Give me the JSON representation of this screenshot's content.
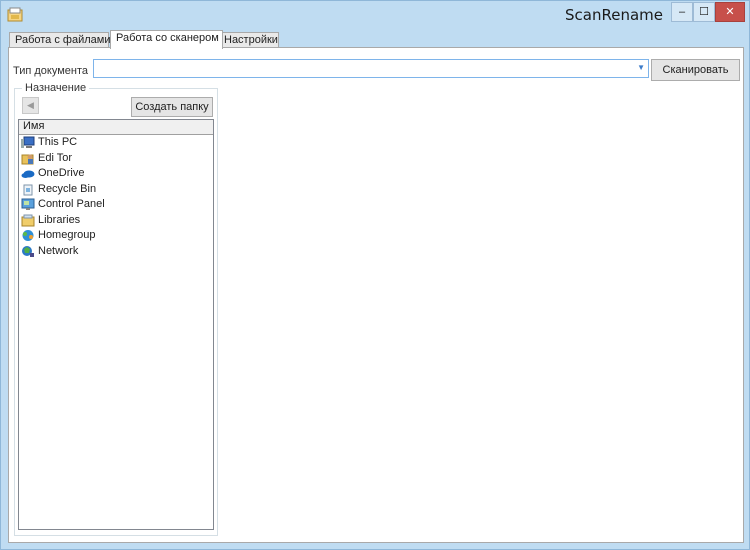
{
  "window": {
    "title": "ScanRename",
    "controls": {
      "minimize": "–",
      "maximize": "☐",
      "close": "✕"
    }
  },
  "tabs": [
    {
      "label": "Работа с файлами",
      "active": false
    },
    {
      "label": "Работа со сканером",
      "active": true
    },
    {
      "label": "Настройки",
      "active": false
    }
  ],
  "scanner": {
    "doc_type_label": "Тип документа",
    "doc_type_value": "",
    "scan_button": "Сканировать"
  },
  "destination": {
    "legend": "Назначение",
    "back_icon": "back-arrow-icon",
    "new_folder_button": "Создать папку",
    "list_header": "Имя",
    "items": [
      {
        "label": "This PC",
        "icon": "computer-icon"
      },
      {
        "label": "Edi Tor",
        "icon": "user-folder-icon"
      },
      {
        "label": "OneDrive",
        "icon": "onedrive-icon"
      },
      {
        "label": "Recycle Bin",
        "icon": "recycle-bin-icon"
      },
      {
        "label": "Control Panel",
        "icon": "control-panel-icon"
      },
      {
        "label": "Libraries",
        "icon": "libraries-icon"
      },
      {
        "label": "Homegroup",
        "icon": "homegroup-icon"
      },
      {
        "label": "Network",
        "icon": "network-icon"
      }
    ]
  },
  "colors": {
    "frame": "#bfdcf2",
    "close_button": "#c7504a",
    "combo_border": "#7eb4ea"
  }
}
